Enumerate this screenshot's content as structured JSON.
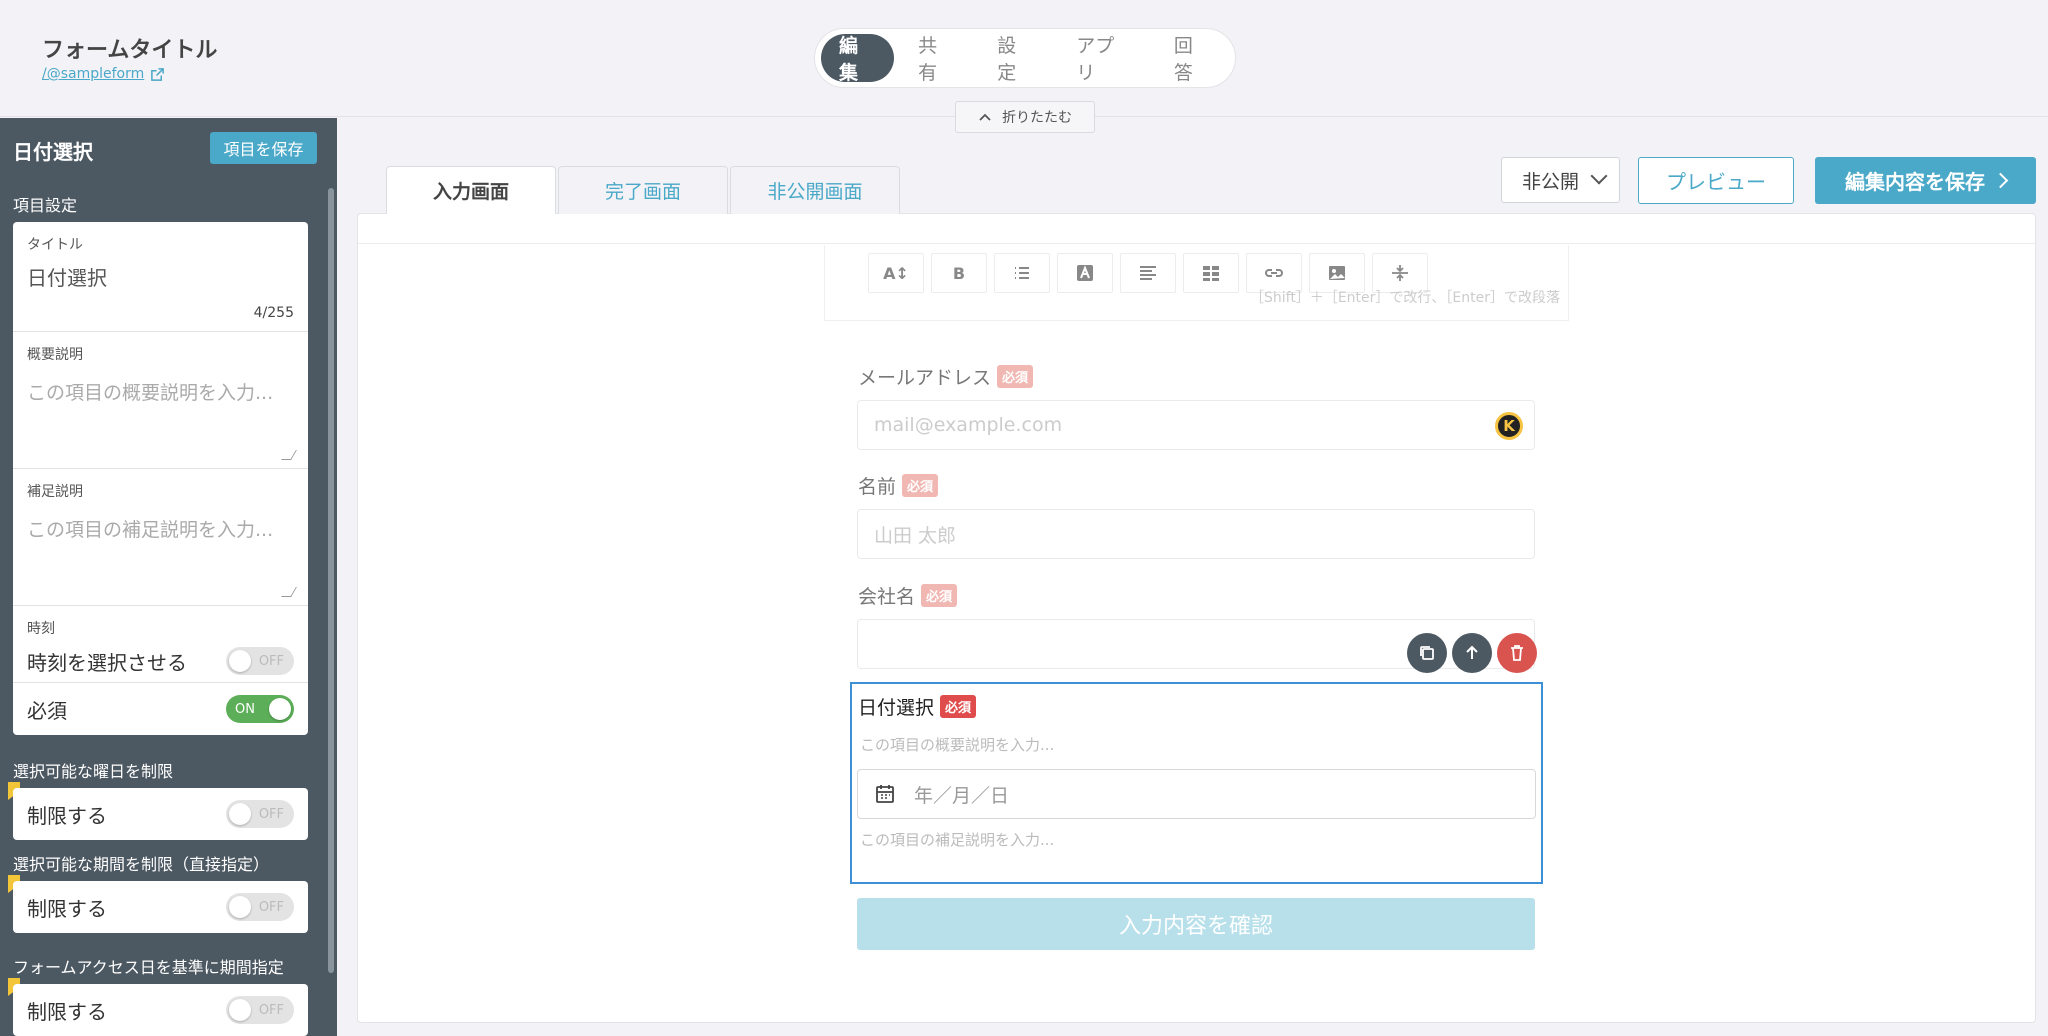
{
  "header": {
    "form_title": "フォームタイトル",
    "form_link": "/@sampleform",
    "tabs": [
      {
        "label": "編集",
        "active": true
      },
      {
        "label": "共有"
      },
      {
        "label": "設定"
      },
      {
        "label": "アプリ"
      },
      {
        "label": "回答"
      }
    ],
    "collapse_label": "折りたたむ"
  },
  "sidebar": {
    "title": "日付選択",
    "save_label": "項目を保存",
    "section_label": "項目設定",
    "title_field": {
      "label": "タイトル",
      "value": "日付選択",
      "counter": "4/255"
    },
    "summary_field": {
      "label": "概要説明",
      "placeholder": "この項目の概要説明を入力..."
    },
    "supplement_field": {
      "label": "補足説明",
      "placeholder": "この項目の補足説明を入力..."
    },
    "time_field": {
      "label": "時刻",
      "option": "時刻を選択させる",
      "toggle": "OFF"
    },
    "required_field": {
      "label": "必須",
      "toggle": "ON"
    },
    "weekday_limit": {
      "label": "選択可能な曜日を制限",
      "option": "制限する",
      "toggle": "OFF"
    },
    "period_limit": {
      "label": "選択可能な期間を制限（直接指定）",
      "option": "制限する",
      "toggle": "OFF"
    },
    "access_limit": {
      "label": "フォームアクセス日を基準に期間指定",
      "option": "制限する",
      "toggle": "OFF"
    }
  },
  "content": {
    "sub_tabs": [
      {
        "label": "入力画面",
        "active": true
      },
      {
        "label": "完了画面"
      },
      {
        "label": "非公開画面"
      }
    ],
    "visibility": "非公開",
    "preview_label": "プレビュー",
    "save_label": "編集内容を保存",
    "toolbar_hint": "［Shift］＋［Enter］で改行、［Enter］で改段落",
    "required_badge": "必須",
    "fields": {
      "email": {
        "label": "メールアドレス",
        "placeholder": "mail@example.com"
      },
      "name": {
        "label": "名前",
        "placeholder": "山田 太郎"
      },
      "company": {
        "label": "会社名",
        "placeholder": ""
      }
    },
    "selected_field": {
      "label": "日付選択",
      "summary_placeholder": "この項目の概要説明を入力...",
      "date_placeholder": "年／月／日",
      "supplement_placeholder": "この項目の補足説明を入力..."
    },
    "confirm_label": "入力内容を確認"
  },
  "colors": {
    "sidebar_bg": "#4c5862",
    "accent": "#4aa8c8",
    "toggle_on": "#5cae58",
    "required_badge": "#e04c4c",
    "selected_border": "#3d8fd6"
  }
}
